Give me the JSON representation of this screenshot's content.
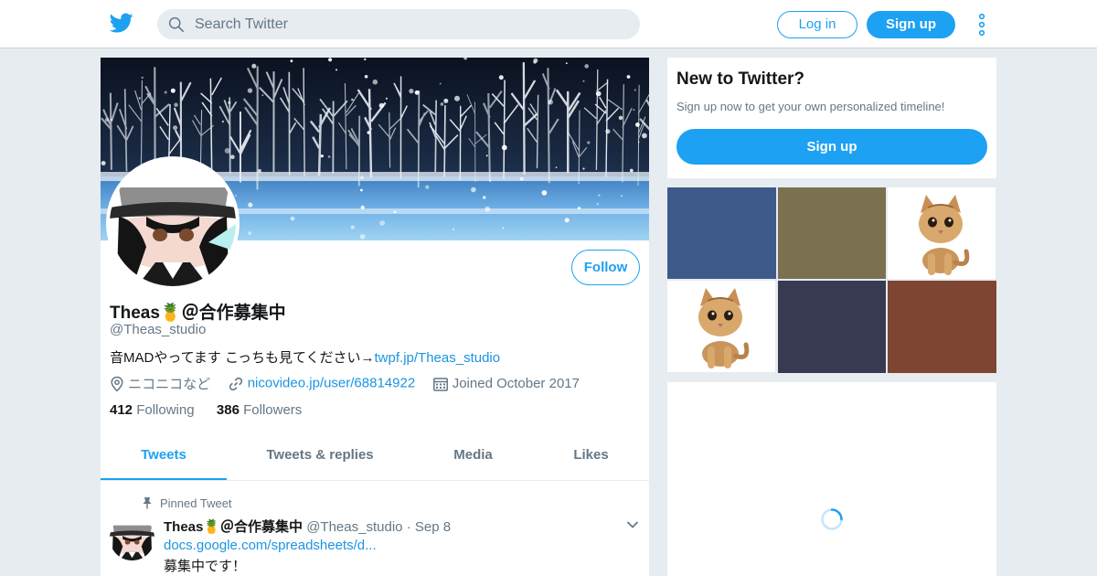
{
  "header": {
    "logo_icon": "twitter-bird-icon",
    "search_placeholder": "Search Twitter",
    "login_label": "Log in",
    "signup_label": "Sign up",
    "more_icon": "vertical-dots-icon"
  },
  "colors": {
    "accent": "#1da1f2",
    "link": "#1b95e0",
    "background": "#e6ecf0",
    "secondary_text": "#657786"
  },
  "profile": {
    "follow_label": "Follow",
    "display_name": "Theas🍍＠合作募集中",
    "handle": "@Theas_studio",
    "bio_text": "音MADやってます こっちも見てください→",
    "bio_link": "twpf.jp/Theas_studio",
    "location": "ニコニコなど",
    "website": "nicovideo.jp/user/68814922",
    "joined": "Joined October 2017",
    "following_count": "412",
    "following_label": "Following",
    "followers_count": "386",
    "followers_label": "Followers"
  },
  "tabs": [
    {
      "label": "Tweets",
      "active": true
    },
    {
      "label": "Tweets & replies",
      "active": false
    },
    {
      "label": "Media",
      "active": false
    },
    {
      "label": "Likes",
      "active": false
    }
  ],
  "pinned_tweet": {
    "pinned_label": "Pinned Tweet",
    "author_name": "Theas🍍＠合作募集中",
    "author_handle": "@Theas_studio",
    "separator": "·",
    "date": "Sep 8",
    "link": "docs.google.com/spreadsheets/d...",
    "text": "募集中です！"
  },
  "sidebar": {
    "title": "New to Twitter?",
    "subtitle": "Sign up now to get your own personalized timeline!",
    "signup_label": "Sign up"
  },
  "media_grid": [
    {
      "kind": "color",
      "color": "#3e5a8a"
    },
    {
      "kind": "color",
      "color": "#7b7050"
    },
    {
      "kind": "kitten"
    },
    {
      "kind": "kitten"
    },
    {
      "kind": "color",
      "color": "#383a52"
    },
    {
      "kind": "color",
      "color": "#7e4632"
    }
  ]
}
